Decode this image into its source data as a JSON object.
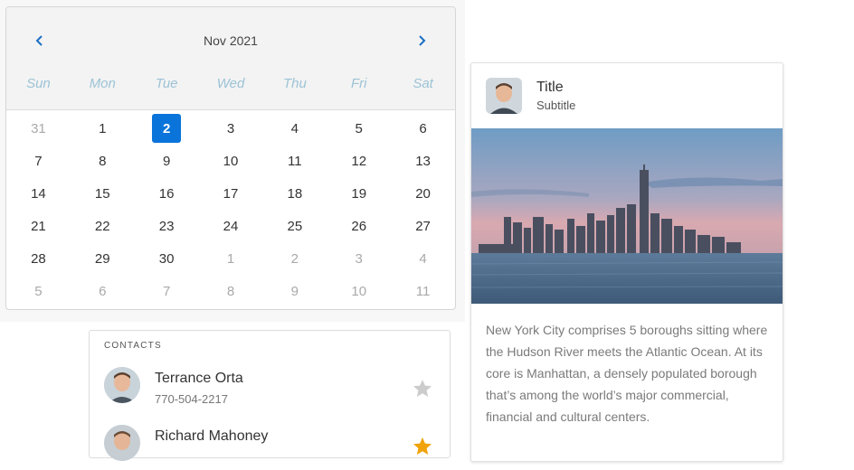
{
  "calendar": {
    "title": "Nov 2021",
    "weekdays": [
      "Sun",
      "Mon",
      "Tue",
      "Wed",
      "Thu",
      "Fri",
      "Sat"
    ],
    "weeks": [
      [
        "31",
        "1",
        "2",
        "3",
        "4",
        "5",
        "6"
      ],
      [
        "7",
        "8",
        "9",
        "10",
        "11",
        "12",
        "13"
      ],
      [
        "14",
        "15",
        "16",
        "17",
        "18",
        "19",
        "20"
      ],
      [
        "21",
        "22",
        "23",
        "24",
        "25",
        "26",
        "27"
      ],
      [
        "28",
        "29",
        "30",
        "1",
        "2",
        "3",
        "4"
      ],
      [
        "5",
        "6",
        "7",
        "8",
        "9",
        "10",
        "11"
      ]
    ],
    "muted": [
      [
        0,
        0
      ],
      [
        4,
        3
      ],
      [
        4,
        4
      ],
      [
        4,
        5
      ],
      [
        4,
        6
      ],
      [
        5,
        0
      ],
      [
        5,
        1
      ],
      [
        5,
        2
      ],
      [
        5,
        3
      ],
      [
        5,
        4
      ],
      [
        5,
        5
      ],
      [
        5,
        6
      ]
    ],
    "selected": [
      0,
      2
    ],
    "accent_color": "#0a74da",
    "weekday_color": "#9cc3d6"
  },
  "contacts": {
    "title": "CONTACTS",
    "items": [
      {
        "name": "Terrance Orta",
        "phone": "770-504-2217",
        "starred": false
      },
      {
        "name": "Richard Mahoney",
        "phone": "",
        "starred": true
      }
    ],
    "star_on_color": "#f0a30a",
    "star_off_color": "#cccccc"
  },
  "card": {
    "title": "Title",
    "subtitle": "Subtitle",
    "image": "new-york-skyline",
    "text": "New York City comprises 5 boroughs sitting where the Hudson River meets the Atlantic Ocean. At its core is Manhattan, a densely populated borough that’s among the world’s major commercial, financial and cultural centers."
  }
}
